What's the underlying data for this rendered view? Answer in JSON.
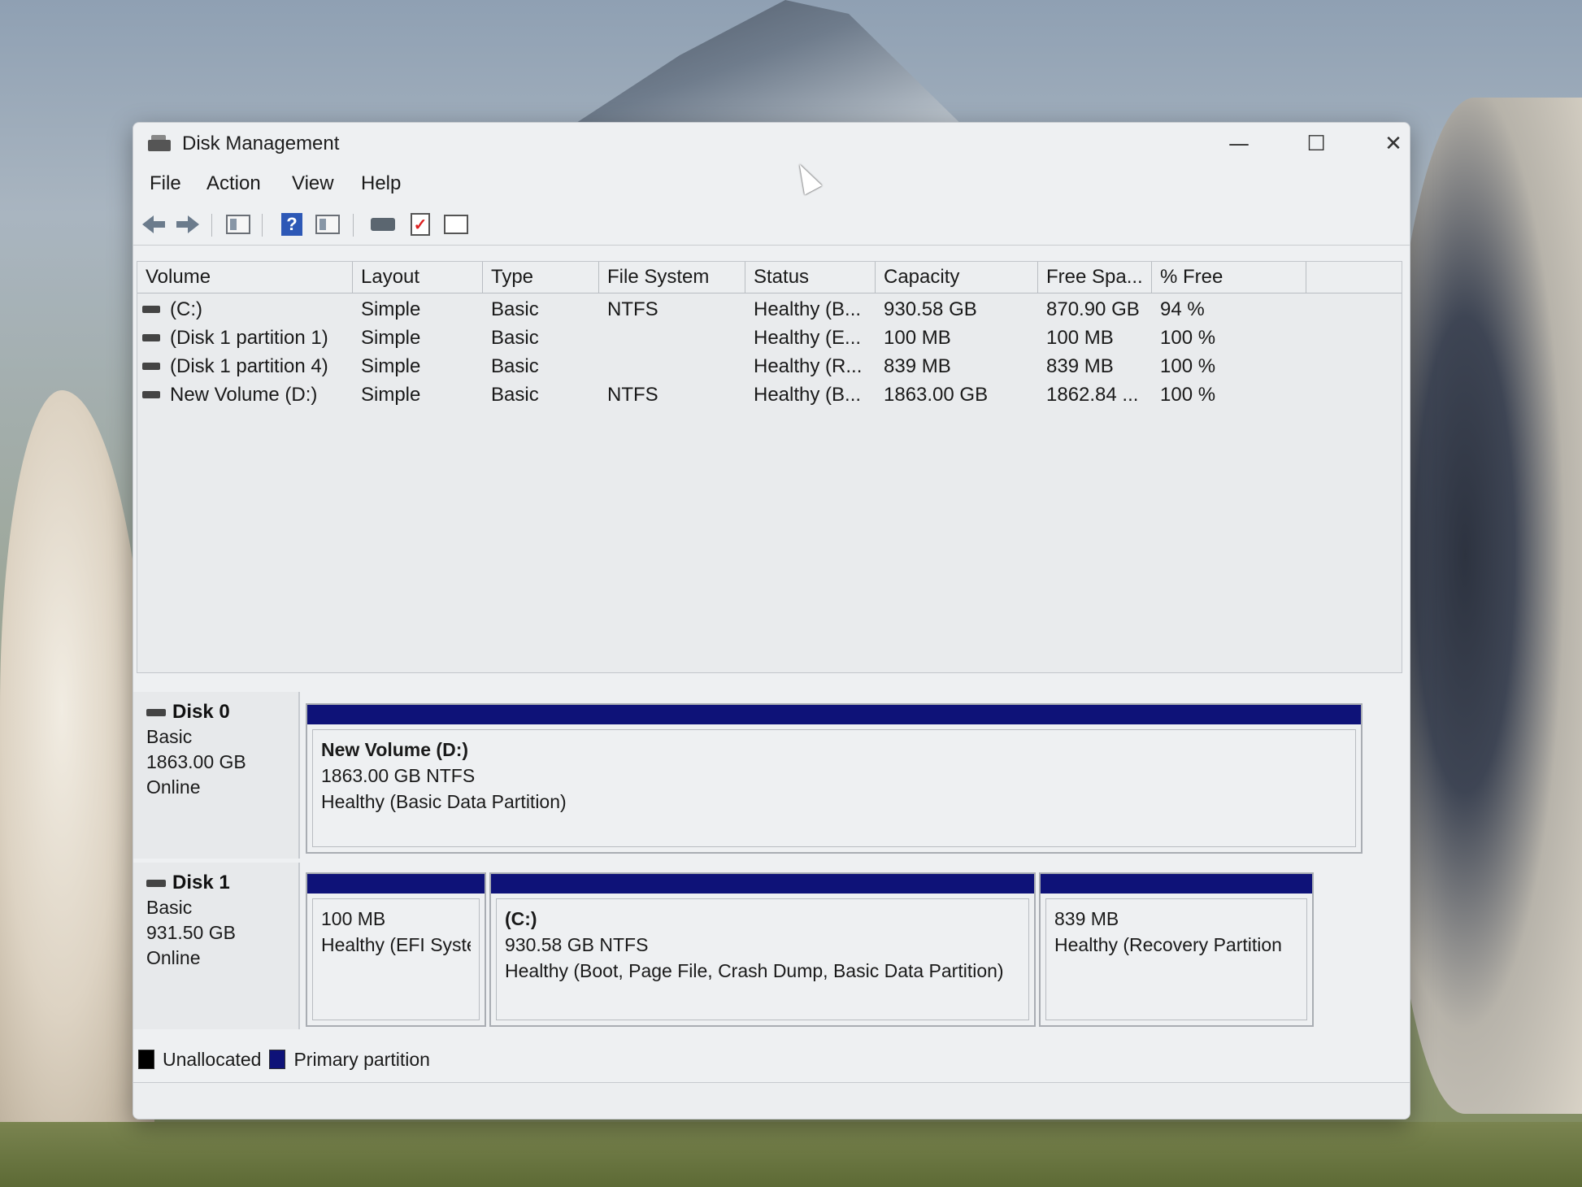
{
  "window": {
    "title": "Disk Management"
  },
  "menubar": {
    "items": [
      "File",
      "Action",
      "View",
      "Help"
    ]
  },
  "toolbar": {
    "buttons": [
      "back-icon",
      "forward-icon",
      "console-tree-icon",
      "help-icon",
      "properties-icon",
      "connect-disk-icon",
      "checkmark-icon",
      "list-view-icon"
    ]
  },
  "volume_table": {
    "headers": [
      "Volume",
      "Layout",
      "Type",
      "File System",
      "Status",
      "Capacity",
      "Free Spa...",
      "% Free"
    ],
    "rows": [
      {
        "volume": "(C:)",
        "layout": "Simple",
        "type": "Basic",
        "fs": "NTFS",
        "status": "Healthy (B...",
        "capacity": "930.58 GB",
        "free": "870.90 GB",
        "pct": "94 %"
      },
      {
        "volume": "(Disk 1 partition 1)",
        "layout": "Simple",
        "type": "Basic",
        "fs": "",
        "status": "Healthy (E...",
        "capacity": "100 MB",
        "free": "100 MB",
        "pct": "100 %"
      },
      {
        "volume": "(Disk 1 partition 4)",
        "layout": "Simple",
        "type": "Basic",
        "fs": "",
        "status": "Healthy (R...",
        "capacity": "839 MB",
        "free": "839 MB",
        "pct": "100 %"
      },
      {
        "volume": "New Volume (D:)",
        "layout": "Simple",
        "type": "Basic",
        "fs": "NTFS",
        "status": "Healthy (B...",
        "capacity": "1863.00 GB",
        "free": "1862.84 ...",
        "pct": "100 %"
      }
    ]
  },
  "disks": [
    {
      "name": "Disk 0",
      "type": "Basic",
      "size": "1863.00 GB",
      "state": "Online",
      "partitions": [
        {
          "name": "New Volume  (D:)",
          "size_fs": "1863.00 GB NTFS",
          "status": "Healthy (Basic Data Partition)"
        }
      ]
    },
    {
      "name": "Disk 1",
      "type": "Basic",
      "size": "931.50 GB",
      "state": "Online",
      "partitions": [
        {
          "name": "",
          "size_fs": "100 MB",
          "status": "Healthy (EFI Syste"
        },
        {
          "name": "(C:)",
          "size_fs": "930.58 GB NTFS",
          "status": "Healthy (Boot, Page File, Crash Dump, Basic Data Partition)"
        },
        {
          "name": "",
          "size_fs": "839 MB",
          "status": "Healthy (Recovery Partition"
        }
      ]
    }
  ],
  "legend": {
    "items": [
      {
        "label": "Unallocated",
        "color": "#000000"
      },
      {
        "label": "Primary partition",
        "color": "#0e1278"
      }
    ]
  },
  "colors": {
    "primary_partition": "#0e1278",
    "unallocated": "#000000"
  }
}
